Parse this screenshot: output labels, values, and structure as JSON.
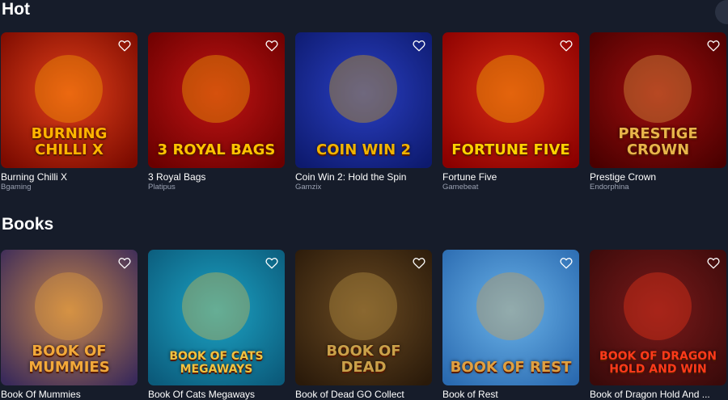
{
  "sections": [
    {
      "title": "Hot",
      "games": [
        {
          "name": "Burning Chilli X",
          "provider": "Bgaming",
          "art_title": "BURNING CHILLI X",
          "colors": [
            "#7a0a00",
            "#e2401a",
            "#ffb400"
          ]
        },
        {
          "name": "3 Royal Bags",
          "provider": "Platipus",
          "art_title": "3 ROYAL BAGS",
          "colors": [
            "#6a0000",
            "#c01414",
            "#ffc400"
          ]
        },
        {
          "name": "Coin Win 2: Hold the Spin",
          "provider": "Gamzix",
          "art_title": "COIN WIN 2",
          "colors": [
            "#0d1a6e",
            "#2a3fc2",
            "#f0b400"
          ]
        },
        {
          "name": "Fortune Five",
          "provider": "Gamebeat",
          "art_title": "FORTUNE FIVE",
          "colors": [
            "#8a0000",
            "#d62a14",
            "#ffd200"
          ]
        },
        {
          "name": "Prestige Crown",
          "provider": "Endorphina",
          "art_title": "PRESTIGE CROWN",
          "colors": [
            "#4a0000",
            "#9e0e0e",
            "#e8b54a"
          ]
        }
      ]
    },
    {
      "title": "Books",
      "games": [
        {
          "name": "Book Of Mummies",
          "provider": "",
          "art_title": "BOOK OF MUMMIES",
          "colors": [
            "#3a2a5a",
            "#c7864a",
            "#f2a93a"
          ]
        },
        {
          "name": "Book Of Cats Megaways",
          "provider": "",
          "art_title": "BOOK OF CATS MEGAWAYS",
          "colors": [
            "#0b5a7a",
            "#1ca3c4",
            "#f0c240"
          ]
        },
        {
          "name": "Book of Dead GO Collect",
          "provider": "",
          "art_title": "BOOK OF DEAD",
          "colors": [
            "#2a1a0a",
            "#6a4a22",
            "#c9a14a"
          ]
        },
        {
          "name": "Book of Rest",
          "provider": "",
          "art_title": "BOOK OF REST",
          "colors": [
            "#2a6ab0",
            "#6ab2e8",
            "#e0a040"
          ]
        },
        {
          "name": "Book of Dragon Hold And ...",
          "provider": "",
          "art_title": "BOOK OF DRAGON HOLD AND WIN",
          "colors": [
            "#3a0a0a",
            "#7a1a1a",
            "#ff3a1a"
          ]
        }
      ]
    }
  ],
  "icons": {
    "favorite": "heart-outline-icon",
    "scroll": "scroll-right-icon"
  }
}
